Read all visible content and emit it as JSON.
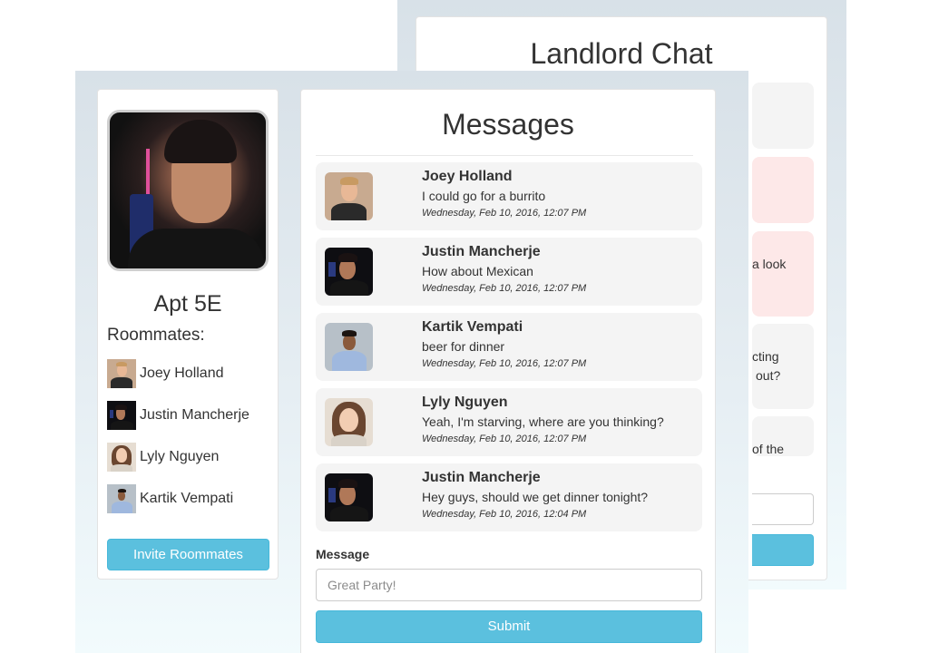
{
  "landlord_chat": {
    "title": "Landlord Chat",
    "partial_lines": [
      "a look",
      "cting",
      "out?",
      "of the"
    ]
  },
  "sidebar": {
    "apartment_title": "Apt 5E",
    "roommates_heading": "Roommates:",
    "roommates": [
      {
        "name": "Joey Holland",
        "avatar": "joey"
      },
      {
        "name": "Justin Mancherje",
        "avatar": "justin"
      },
      {
        "name": "Lyly Nguyen",
        "avatar": "lyly"
      },
      {
        "name": "Kartik Vempati",
        "avatar": "kartik"
      }
    ],
    "invite_button": "Invite Roommates"
  },
  "messages": {
    "title": "Messages",
    "items": [
      {
        "name": "Joey Holland",
        "text": "I could go for a burrito",
        "time": "Wednesday, Feb 10, 2016, 12:07 PM",
        "avatar": "joey"
      },
      {
        "name": "Justin Mancherje",
        "text": "How about Mexican",
        "time": "Wednesday, Feb 10, 2016, 12:07 PM",
        "avatar": "justin"
      },
      {
        "name": "Kartik Vempati",
        "text": "beer for dinner",
        "time": "Wednesday, Feb 10, 2016, 12:07 PM",
        "avatar": "kartik"
      },
      {
        "name": "Lyly Nguyen",
        "text": "Yeah, I'm starving, where are you thinking?",
        "time": "Wednesday, Feb 10, 2016, 12:07 PM",
        "avatar": "lyly"
      },
      {
        "name": "Justin Mancherje",
        "text": "Hey guys, should we get dinner tonight?",
        "time": "Wednesday, Feb 10, 2016, 12:04 PM",
        "avatar": "justin"
      }
    ],
    "field_label": "Message",
    "input_placeholder": "Great Party!",
    "submit_button": "Submit"
  },
  "colors": {
    "accent": "#5bc0de",
    "accent_border": "#46b8da",
    "message_bg": "#f4f4f4",
    "landlord_message_pink": "#fde8e8",
    "landlord_message_gray": "#f4f4f4"
  }
}
